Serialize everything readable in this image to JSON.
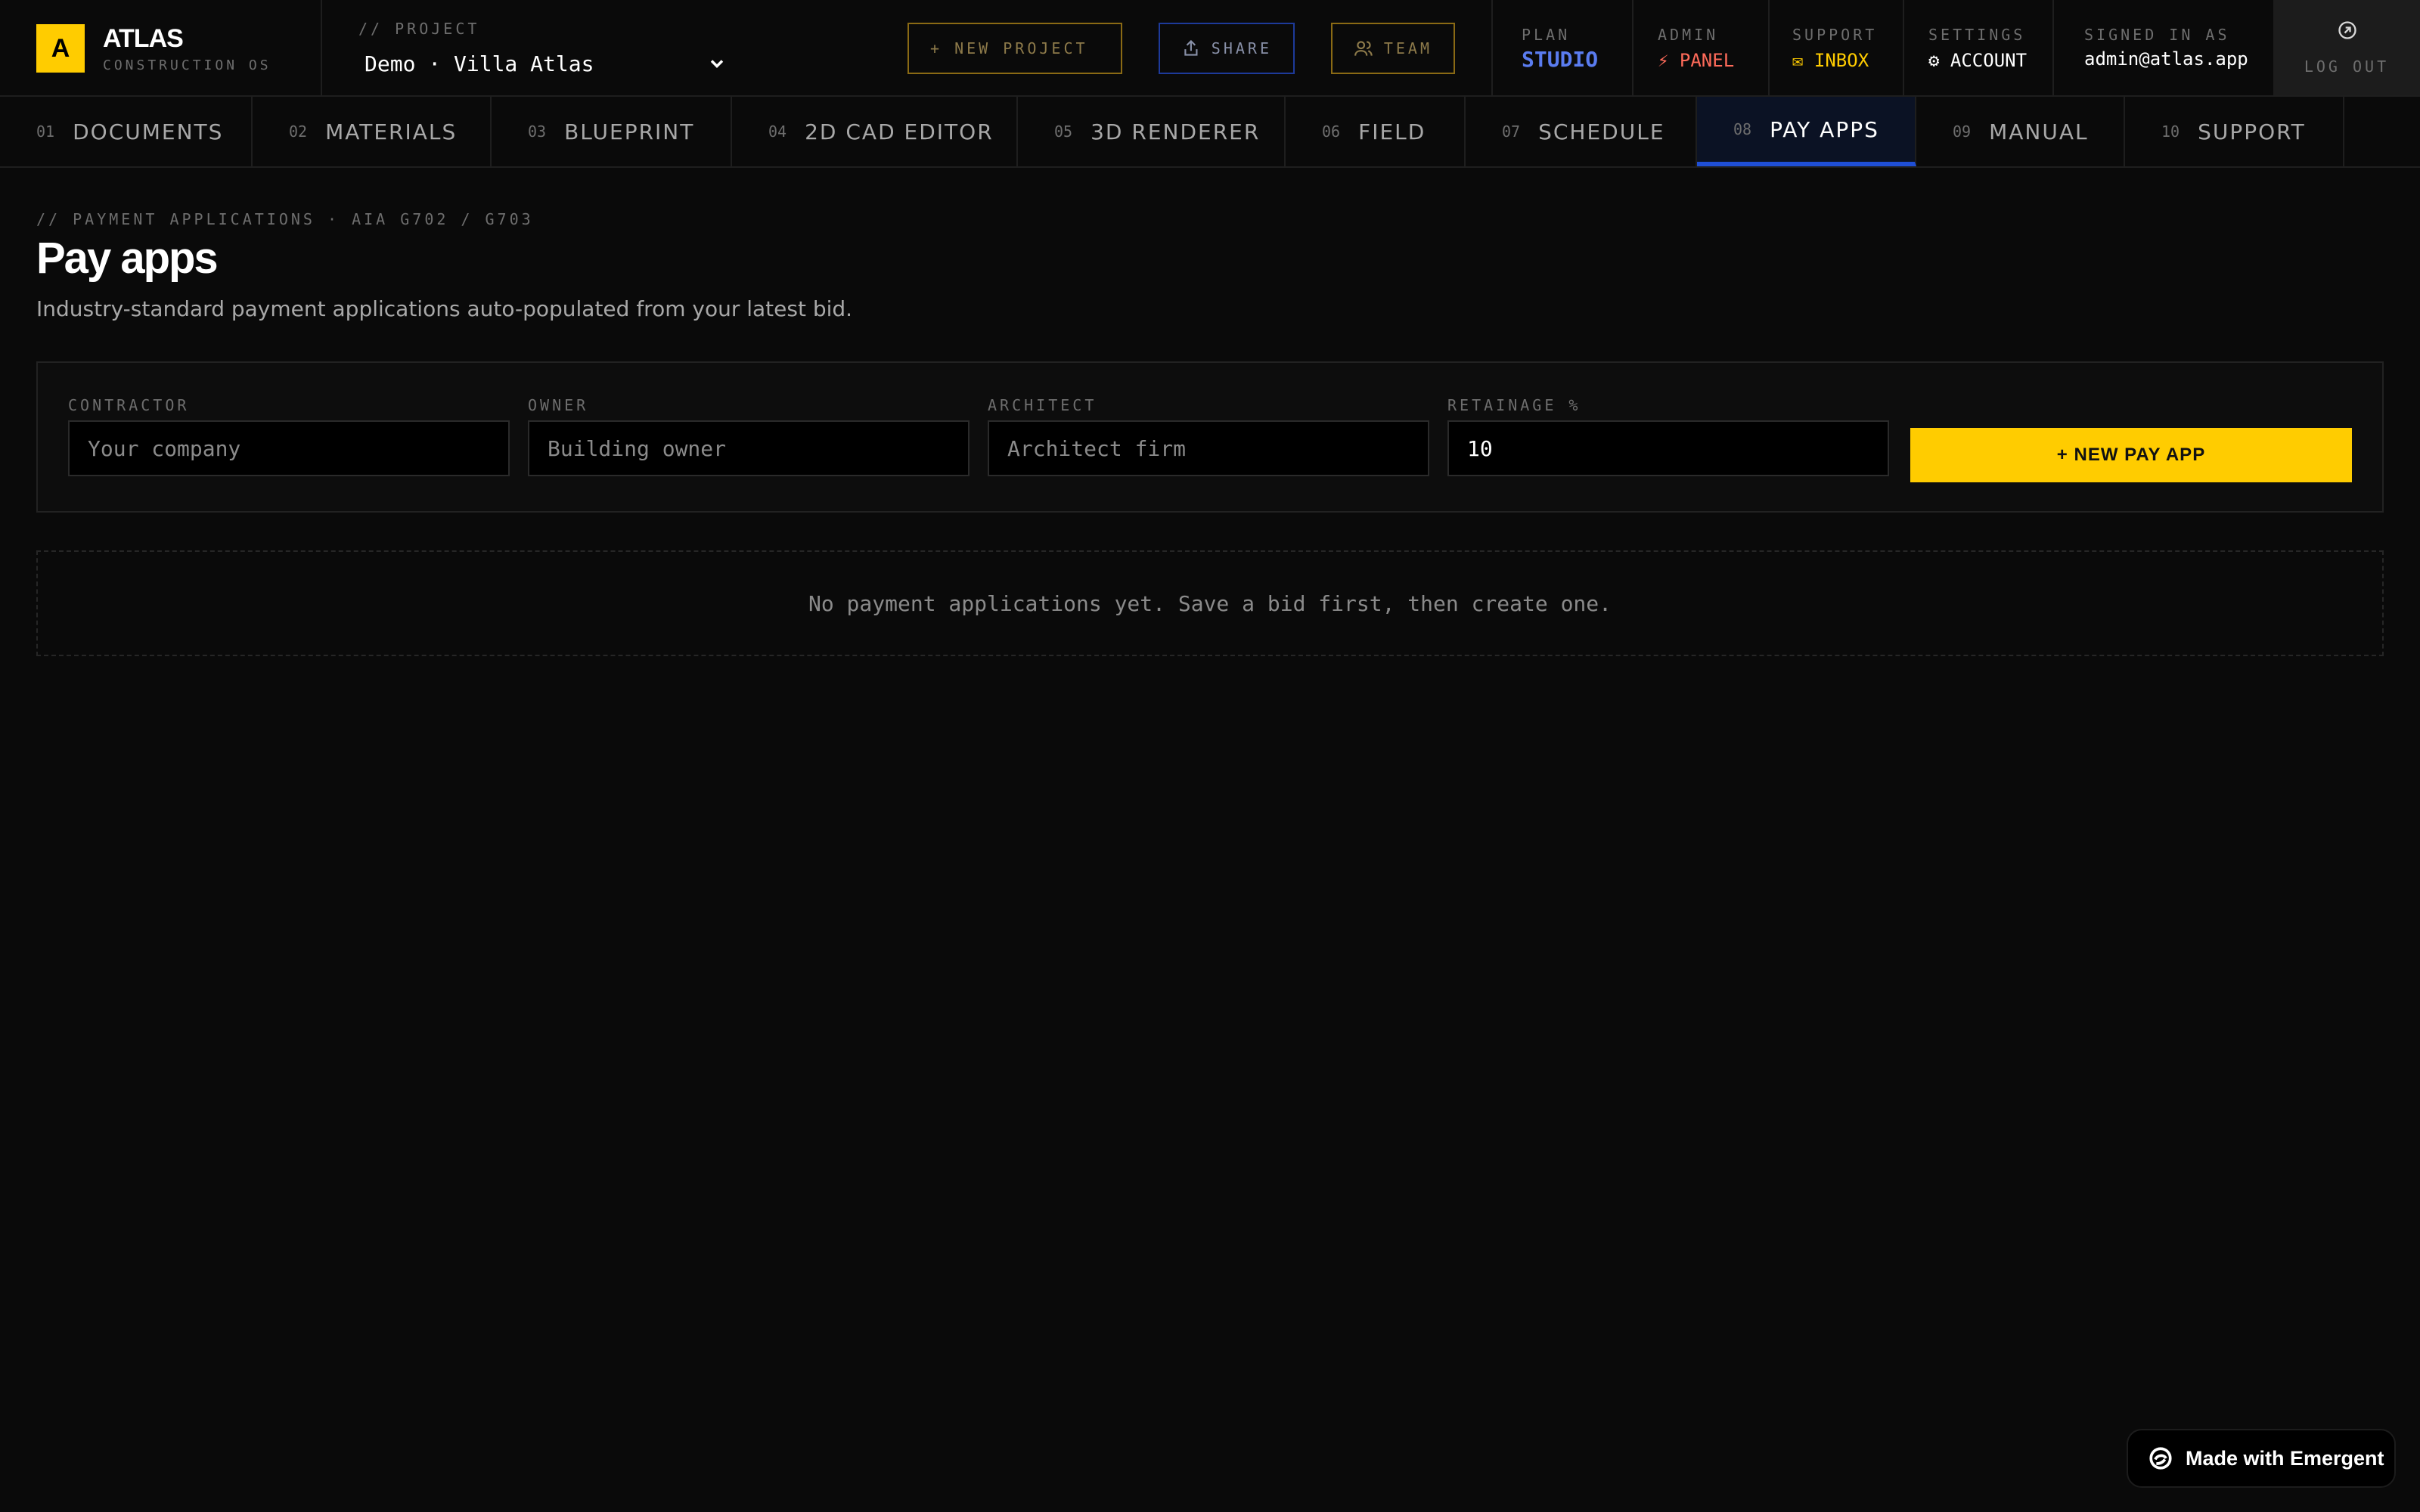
{
  "brand": {
    "logo_letter": "A",
    "name": "ATLAS",
    "subtitle": "CONSTRUCTION OS"
  },
  "project": {
    "label": "// PROJECT",
    "selected": "Demo · Villa Atlas"
  },
  "header_buttons": {
    "new_project": "+ NEW PROJECT",
    "share": "SHARE",
    "team": "TEAM"
  },
  "header_cells": {
    "plan": {
      "label": "PLAN",
      "value": "STUDIO"
    },
    "admin": {
      "label": "ADMIN",
      "value": "⚡ PANEL"
    },
    "support": {
      "label": "SUPPORT",
      "value": "✉ INBOX"
    },
    "settings": {
      "label": "SETTINGS",
      "value": "⚙ ACCOUNT"
    },
    "signed_in": {
      "label": "SIGNED IN AS",
      "value": "admin@atlas.app"
    },
    "logout": "LOG OUT"
  },
  "tabs": [
    {
      "num": "01",
      "label": "DOCUMENTS"
    },
    {
      "num": "02",
      "label": "MATERIALS"
    },
    {
      "num": "03",
      "label": "BLUEPRINT"
    },
    {
      "num": "04",
      "label": "2D CAD EDITOR"
    },
    {
      "num": "05",
      "label": "3D RENDERER"
    },
    {
      "num": "06",
      "label": "FIELD"
    },
    {
      "num": "07",
      "label": "SCHEDULE"
    },
    {
      "num": "08",
      "label": "PAY APPS"
    },
    {
      "num": "09",
      "label": "MANUAL"
    },
    {
      "num": "10",
      "label": "SUPPORT"
    }
  ],
  "active_tab": "PAY APPS",
  "page": {
    "breadcrumb": "// PAYMENT APPLICATIONS · AIA G702 / G703",
    "title": "Pay apps",
    "subtitle": "Industry-standard payment applications auto-populated from your latest bid."
  },
  "form": {
    "contractor": {
      "label": "CONTRACTOR",
      "placeholder": "Your company",
      "value": ""
    },
    "owner": {
      "label": "OWNER",
      "placeholder": "Building owner",
      "value": ""
    },
    "architect": {
      "label": "ARCHITECT",
      "placeholder": "Architect firm",
      "value": ""
    },
    "retainage": {
      "label": "RETAINAGE %",
      "value": "10"
    },
    "submit_label": "+ NEW PAY APP"
  },
  "empty_state": "No payment applications yet. Save a bid first, then create one.",
  "badge": "Made with Emergent",
  "colors": {
    "accent": "#ffcc00",
    "active_tab": "#1f4fd6",
    "plan": "#5a7cf0",
    "admin": "#ff6b5a",
    "background": "#0a0a0a"
  }
}
